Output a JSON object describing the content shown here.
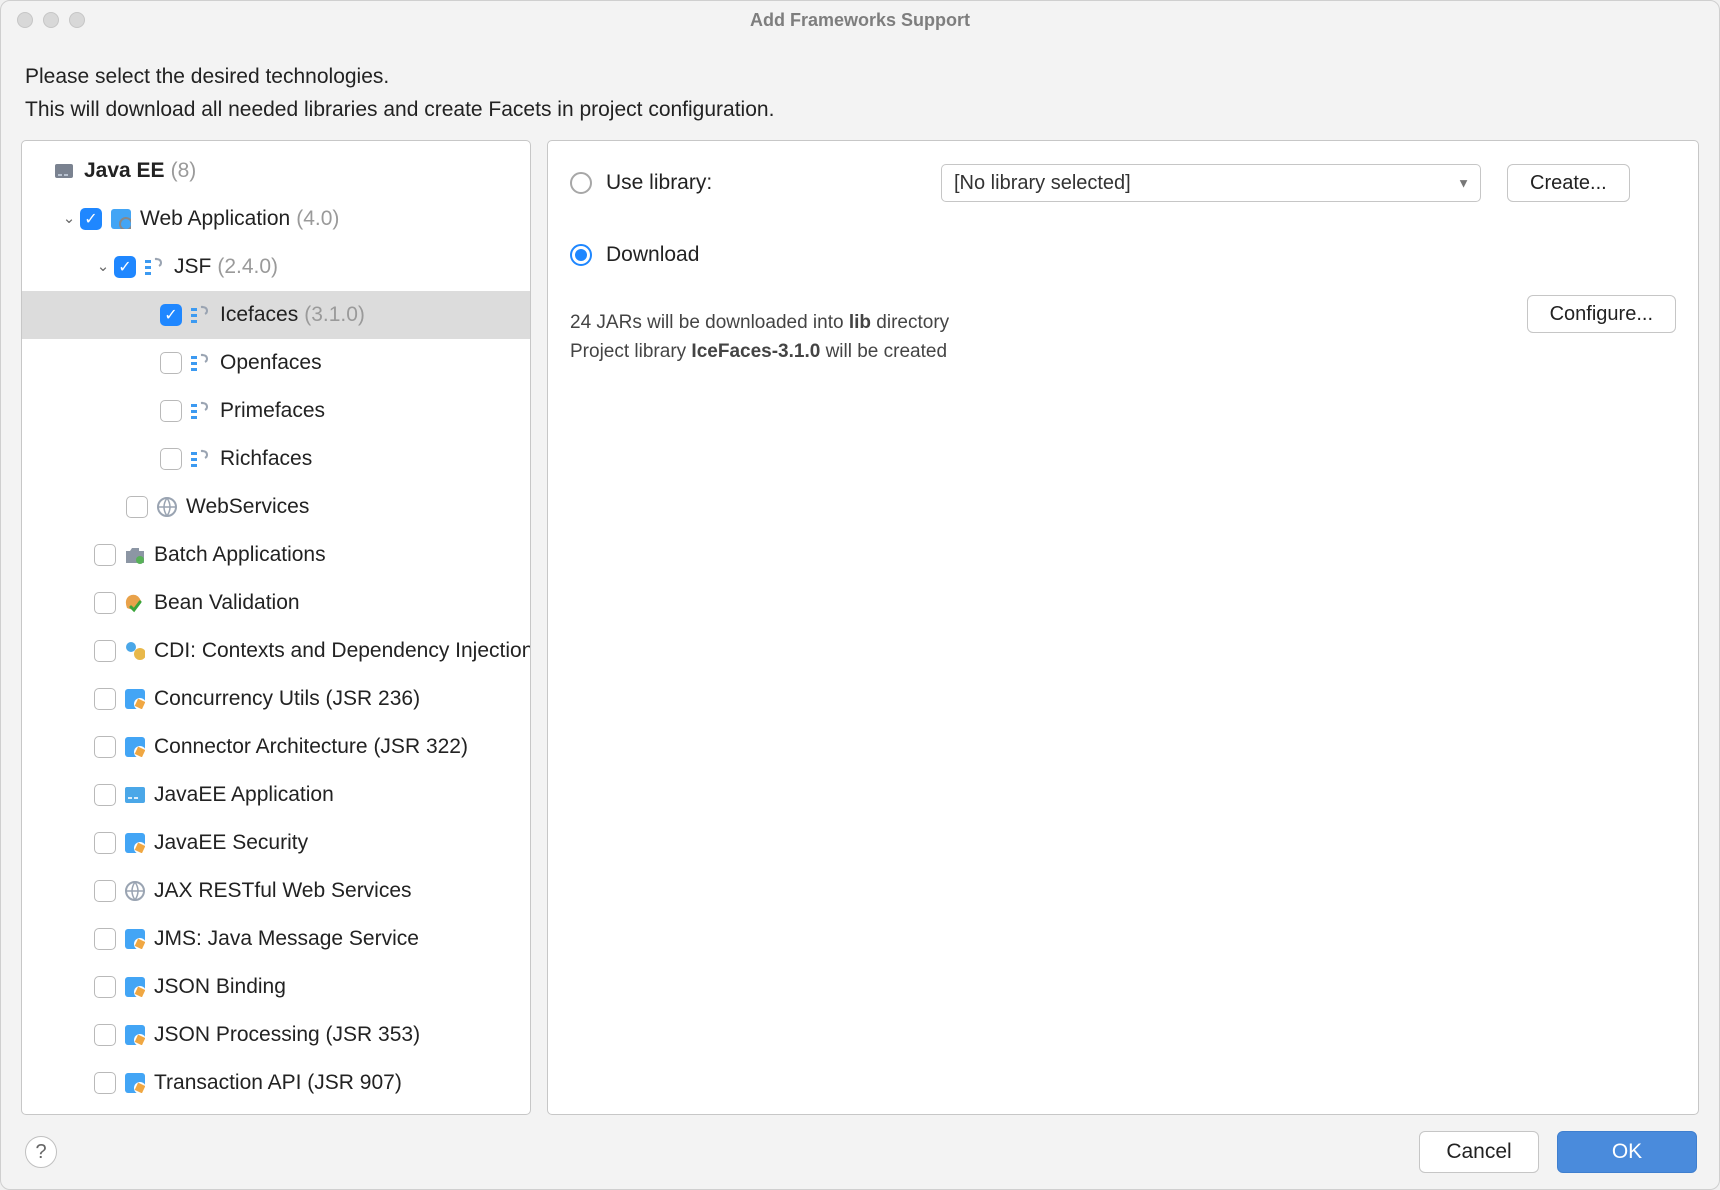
{
  "title": "Add Frameworks Support",
  "instructions_l1": "Please select the desired technologies.",
  "instructions_l2": "This will download all needed libraries and create Facets in project configuration.",
  "tree": {
    "root_label": "Java EE",
    "root_suffix": "(8)",
    "web_app_label": "Web Application",
    "web_app_suffix": "(4.0)",
    "jsf_label": "JSF",
    "jsf_suffix": "(2.4.0)",
    "icefaces_label": "Icefaces",
    "icefaces_suffix": "(3.1.0)",
    "openfaces_label": "Openfaces",
    "primefaces_label": "Primefaces",
    "richfaces_label": "Richfaces",
    "webservices_label": "WebServices",
    "batch_label": "Batch Applications",
    "beanval_label": "Bean Validation",
    "cdi_label": "CDI: Contexts and Dependency Injection",
    "concurrency_label": "Concurrency Utils (JSR 236)",
    "connector_label": "Connector Architecture (JSR 322)",
    "jee_app_label": "JavaEE Application",
    "jee_sec_label": "JavaEE Security",
    "jaxrs_label": "JAX RESTful Web Services",
    "jms_label": "JMS: Java Message Service",
    "jsonb_label": "JSON Binding",
    "jsonp_label": "JSON Processing (JSR 353)",
    "txn_label": "Transaction API (JSR 907)"
  },
  "detail": {
    "use_library_label": "Use library:",
    "library_select_value": "[No library selected]",
    "create_btn": "Create...",
    "download_label": "Download",
    "jar_count": "24",
    "jar_line_prefix": " JARs will be downloaded into ",
    "jar_dir": "lib",
    "jar_line_suffix": " directory",
    "proj_line_prefix": "Project library ",
    "proj_lib_name": "IceFaces-3.1.0",
    "proj_line_suffix": " will be created",
    "configure_btn": "Configure..."
  },
  "footer": {
    "help": "?",
    "cancel": "Cancel",
    "ok": "OK"
  },
  "check_glyph": "✓"
}
